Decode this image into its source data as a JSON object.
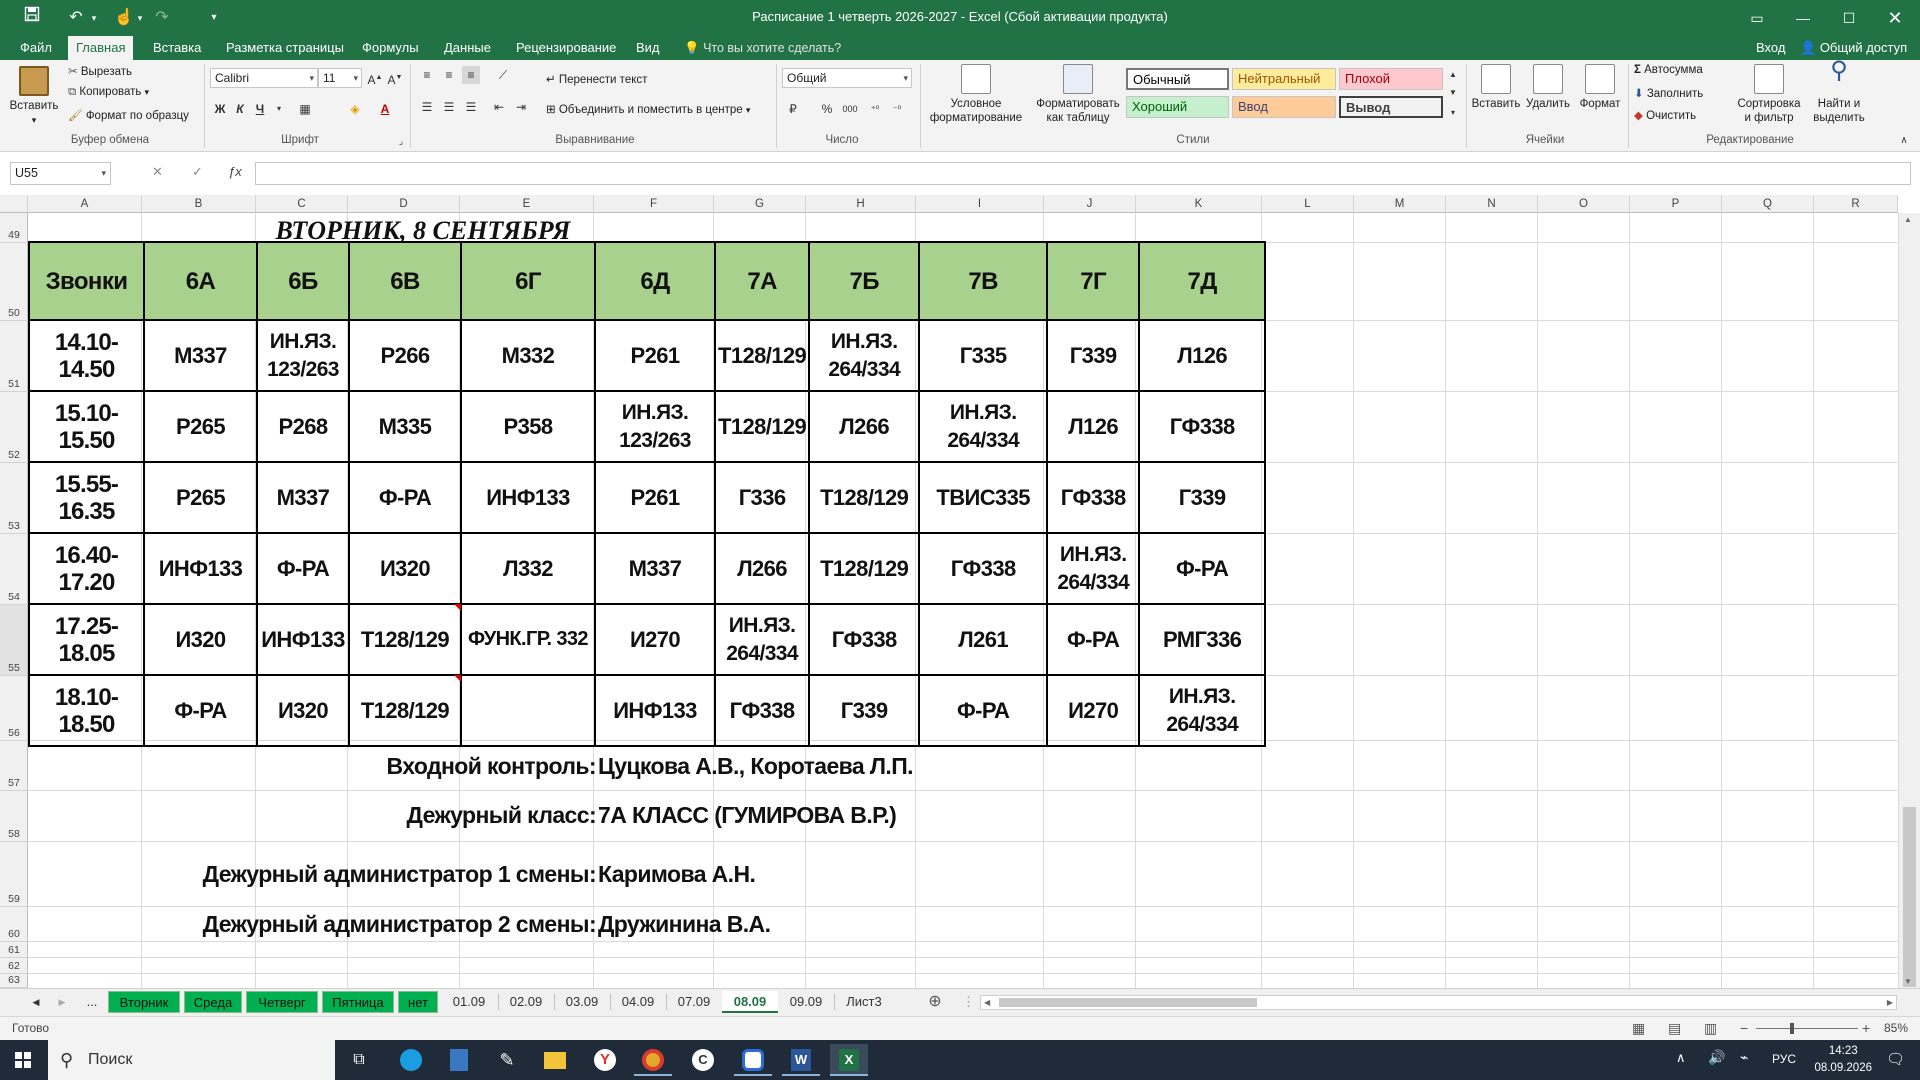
{
  "window": {
    "title": "Расписание 1 четверть 2026-2027 - Excel (Сбой активации продукта)"
  },
  "ribbon_tabs": [
    "Файл",
    "Главная",
    "Вставка",
    "Разметка страницы",
    "Формулы",
    "Данные",
    "Рецензирование",
    "Вид"
  ],
  "tell_me": "Что вы хотите сделать?",
  "signin": "Вход",
  "share": "Общий доступ",
  "ribbon": {
    "paste": "Вставить",
    "cut": "Вырезать",
    "copy": "Копировать",
    "format_painter": "Формат по образцу",
    "font_name": "Calibri",
    "font_size": "11",
    "bold": "Ж",
    "italic": "К",
    "underline": "Ч",
    "wrap_text": "Перенести текст",
    "merge_center": "Объединить и поместить в центре",
    "number_format": "Общий",
    "percent": "%",
    "thousands": "000",
    "cond_format": [
      "Условное",
      "форматирование"
    ],
    "format_table": [
      "Форматировать",
      "как таблицу"
    ],
    "styles": [
      {
        "label": "Обычный",
        "bg": "#ffffff",
        "color": "#000000"
      },
      {
        "label": "Нейтральный",
        "bg": "#ffeb9c",
        "color": "#9c5700"
      },
      {
        "label": "Плохой",
        "bg": "#ffc7ce",
        "color": "#9c0006"
      },
      {
        "label": "Хороший",
        "bg": "#c6efce",
        "color": "#006100"
      },
      {
        "label": "Ввод",
        "bg": "#ffcc99",
        "color": "#3f3f76"
      },
      {
        "label": "Вывод",
        "bg": "#f2f2f2",
        "color": "#3f3f3f"
      }
    ],
    "insert": "Вставить",
    "delete": "Удалить",
    "format": "Формат",
    "autosum": "Автосумма",
    "fill": "Заполнить",
    "clear": "Очистить",
    "sort_filter": [
      "Сортировка",
      "и фильтр"
    ],
    "find_select": [
      "Найти и",
      "выделить"
    ],
    "groups": [
      "Буфер обмена",
      "Шрифт",
      "Выравнивание",
      "Число",
      "Стили",
      "Ячейки",
      "Редактирование"
    ]
  },
  "formula_bar": {
    "name_box": "U55",
    "formula": ""
  },
  "columns": [
    "A",
    "B",
    "C",
    "D",
    "E",
    "F",
    "G",
    "H",
    "I",
    "J",
    "K",
    "L",
    "M",
    "N",
    "O",
    "P",
    "Q",
    "R"
  ],
  "rows": [
    "49",
    "50",
    "51",
    "52",
    "53",
    "54",
    "55",
    "56",
    "57",
    "58",
    "59",
    "60",
    "61",
    "62",
    "63"
  ],
  "schedule": {
    "day_title": "ВТОРНИК, 8 СЕНТЯБРЯ",
    "header": [
      "Звонки",
      "6А",
      "6Б",
      "6В",
      "6Г",
      "6Д",
      "7А",
      "7Б",
      "7В",
      "7Г",
      "7Д"
    ],
    "rows": [
      [
        "14.10-14.50",
        "М337",
        "ИН.ЯЗ. 123/263",
        "Р266",
        "М332",
        "Р261",
        "Т128/129",
        "ИН.ЯЗ. 264/334",
        "Г335",
        "Г339",
        "Л126"
      ],
      [
        "15.10-15.50",
        "Р265",
        "Р268",
        "М335",
        "Р358",
        "ИН.ЯЗ. 123/263",
        "Т128/129",
        "Л266",
        "ИН.ЯЗ. 264/334",
        "Л126",
        "ГФ338"
      ],
      [
        "15.55-16.35",
        "Р265",
        "М337",
        "Ф-РА",
        "ИНФ133",
        "Р261",
        "Г336",
        "Т128/129",
        "ТВИС335",
        "ГФ338",
        "Г339"
      ],
      [
        "16.40-17.20",
        "ИНФ133",
        "Ф-РА",
        "И320",
        "Л332",
        "М337",
        "Л266",
        "Т128/129",
        "ГФ338",
        "ИН.ЯЗ. 264/334",
        "Ф-РА"
      ],
      [
        "17.25-18.05",
        "И320",
        "ИНФ133",
        "Т128/129",
        "ФУНК.ГР. 332",
        "И270",
        "ИН.ЯЗ. 264/334",
        "ГФ338",
        "Л261",
        "Ф-РА",
        "РМГ336"
      ],
      [
        "18.10-18.50",
        "Ф-РА",
        "И320",
        "Т128/129",
        "",
        "ИНФ133",
        "ГФ338",
        "Г339",
        "Ф-РА",
        "И270",
        "ИН.ЯЗ. 264/334"
      ]
    ],
    "info": [
      {
        "label": "Входной контроль:",
        "value": "Цуцкова А.В., Коротаева Л.П."
      },
      {
        "label": "Дежурный класс:",
        "value": "7А КЛАСС (ГУМИРОВА В.Р.)"
      },
      {
        "label": "Дежурный администратор 1 смены:",
        "value": "Каримова А.Н."
      },
      {
        "label": "Дежурный администратор 2 смены:",
        "value": "Дружинина В.А."
      }
    ]
  },
  "sheet_tabs": {
    "more": "...",
    "tabs": [
      "Вторник",
      "Среда",
      "Четверг",
      "Пятница",
      "нет",
      "01.09",
      "02.09",
      "03.09",
      "04.09",
      "07.09",
      "08.09",
      "09.09",
      "Лист3"
    ],
    "active": "08.09"
  },
  "status": {
    "ready": "Готово",
    "zoom": "85%"
  },
  "taskbar": {
    "search": "Поиск",
    "lang": "РУС",
    "time": "14:23",
    "date": "08.09.2026"
  },
  "colors": {
    "excel_green": "#217346",
    "header_fill": "#a9d18e",
    "tab_green": "#00b050"
  }
}
